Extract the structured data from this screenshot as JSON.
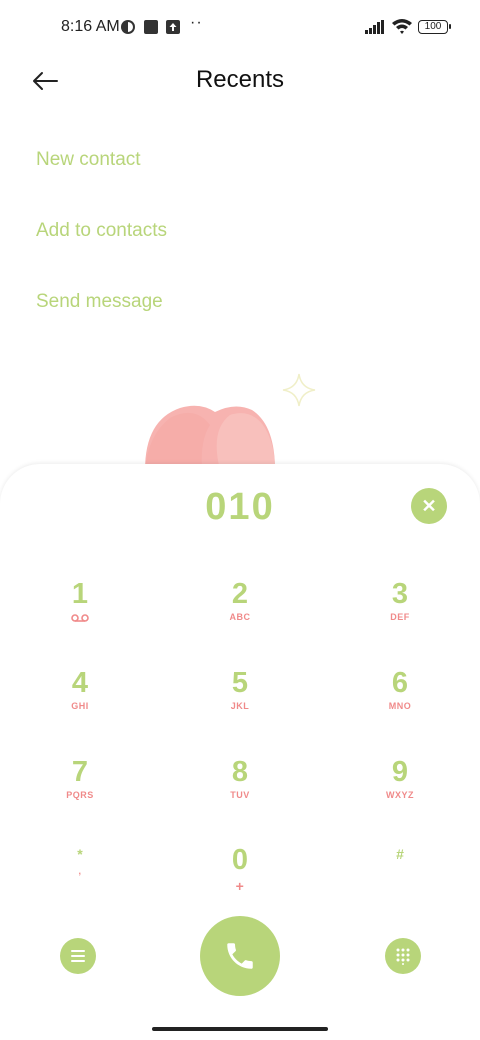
{
  "status_bar": {
    "time": "8:16 AM",
    "dots": "··",
    "battery": "100",
    "icons": [
      "theme-icon",
      "square-icon",
      "upload-icon",
      "signal-icon",
      "wifi-icon",
      "battery-icon"
    ]
  },
  "header": {
    "title": "Recents",
    "back_icon": "back-arrow-icon"
  },
  "actions": [
    {
      "label": "New contact"
    },
    {
      "label": "Add to contacts"
    },
    {
      "label": "Send message"
    }
  ],
  "dialer": {
    "number": "010",
    "clear_icon": "close-icon",
    "keys": [
      {
        "digit": "1",
        "letters": "voicemail-icon"
      },
      {
        "digit": "2",
        "letters": "ABC"
      },
      {
        "digit": "3",
        "letters": "DEF"
      },
      {
        "digit": "4",
        "letters": "GHI"
      },
      {
        "digit": "5",
        "letters": "JKL"
      },
      {
        "digit": "6",
        "letters": "MNO"
      },
      {
        "digit": "7",
        "letters": "PQRS"
      },
      {
        "digit": "8",
        "letters": "TUV"
      },
      {
        "digit": "9",
        "letters": "WXYZ"
      },
      {
        "digit": "*",
        "letters": ","
      },
      {
        "digit": "0",
        "letters": "+"
      },
      {
        "digit": "#",
        "letters": ""
      }
    ],
    "bottom_icons": [
      "menu-icon",
      "phone-icon",
      "keypad-icon"
    ]
  },
  "colors": {
    "accent": "#b8d57a",
    "letters": "#f08a8a",
    "decor_pink": "#f7b3b0"
  }
}
